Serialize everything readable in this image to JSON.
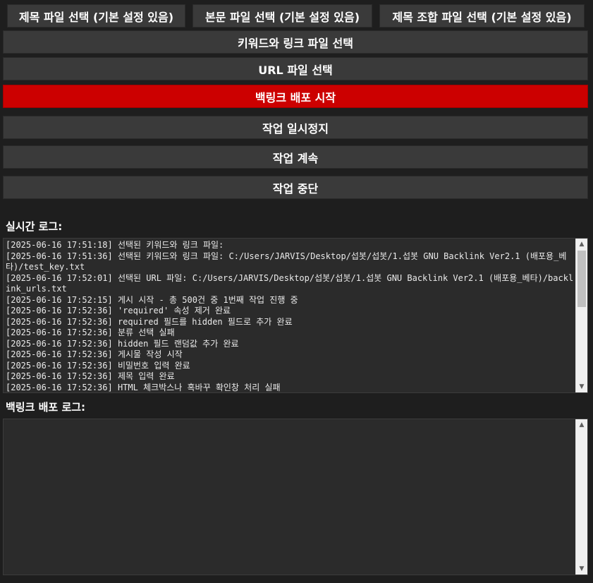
{
  "buttons": {
    "select_title_file": "제목 파일 선택 (기본 설정 있음)",
    "select_body_file": "본문 파일 선택 (기본 설정 있음)",
    "select_title_combo_file": "제목 조합 파일 선택 (기본 설정 있음)",
    "select_keyword_link_file": "키워드와 링크 파일 선택",
    "select_url_file": "URL 파일 선택",
    "start_backlink": "백링크 배포 시작",
    "pause": "작업 일시정지",
    "resume": "작업 계속",
    "stop": "작업 중단"
  },
  "colors": {
    "primary_button": "#cc0000",
    "button": "#3a3a3a",
    "background": "#1e1e1e",
    "log_background": "#2b2b2b"
  },
  "realtime_log": {
    "label": "실시간 로그:",
    "lines": [
      "[2025-06-16 17:51:18] 선택된 키워드와 링크 파일:",
      "[2025-06-16 17:51:36] 선택된 키워드와 링크 파일: C:/Users/JARVIS/Desktop/섭봇/섭봇/1.섭봇 GNU Backlink Ver2.1 (배포용_베타)/test_key.txt",
      "[2025-06-16 17:52:01] 선택된 URL 파일: C:/Users/JARVIS/Desktop/섭봇/섭봇/1.섭봇 GNU Backlink Ver2.1 (배포용_베타)/backlink_urls.txt",
      "[2025-06-16 17:52:15] 게시 시작 - 총 500건 중 1번째 작업 진행 중",
      "[2025-06-16 17:52:36] 'required' 속성 제거 완료",
      "[2025-06-16 17:52:36] required 필드를 hidden 필드로 추가 완료",
      "[2025-06-16 17:52:36] 분류 선택 실패",
      "[2025-06-16 17:52:36] hidden 필드 랜덤값 추가 완료",
      "[2025-06-16 17:52:36] 게시물 작성 시작",
      "[2025-06-16 17:52:36] 비밀번호 입력 완료",
      "[2025-06-16 17:52:36] 제목 입력 완료",
      "[2025-06-16 17:52:36] HTML 체크박스나 혹바꾸 확인창 처리 실패"
    ]
  },
  "deploy_log": {
    "label": "백링크 배포 로그:",
    "lines": []
  }
}
